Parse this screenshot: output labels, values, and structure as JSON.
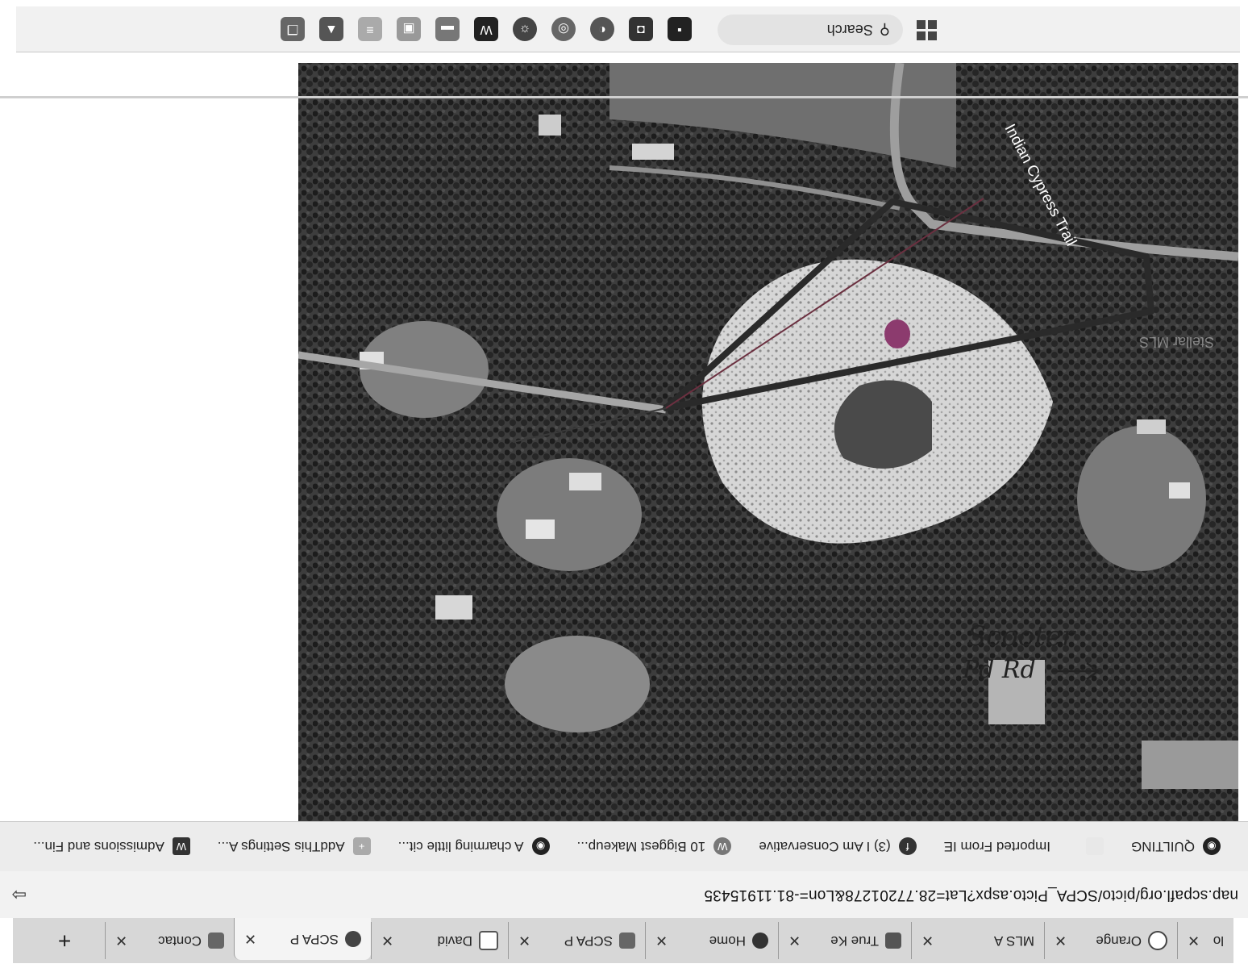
{
  "browser": {
    "tabs": [
      {
        "label": "lo",
        "active": false
      },
      {
        "label": "Orange",
        "active": false
      },
      {
        "label": "MLS A",
        "active": false
      },
      {
        "label": "True Ke",
        "active": false
      },
      {
        "label": "Home",
        "active": false
      },
      {
        "label": "SCPA P",
        "active": false
      },
      {
        "label": "David",
        "active": false
      },
      {
        "label": "SCPA P",
        "active": true
      },
      {
        "label": "Contac",
        "active": false
      }
    ],
    "new_tab_label": "+",
    "close_symbol": "✕",
    "url": "nap.scpafl.org/picto/SCPA_Picto.aspx?Lat=28.77201278&Lon=-81.11915435"
  },
  "favorites": [
    {
      "label": "QUILTING",
      "icon": "globe-icon"
    },
    {
      "label": "",
      "icon": "blank-icon"
    },
    {
      "label": "Imported From IE",
      "icon": "folder-icon"
    },
    {
      "label": "(3) I Am Conservative",
      "icon": "facebook-icon"
    },
    {
      "label": "10 Biggest Makeup...",
      "icon": "wish-icon"
    },
    {
      "label": "A charming little cit...",
      "icon": "globe-icon"
    },
    {
      "label": "AddThis Settings A...",
      "icon": "plus-icon"
    },
    {
      "label": "Admissions and Fin...",
      "icon": "w-icon"
    }
  ],
  "taskbar": {
    "search_label": "Search",
    "icons": [
      "start-icon",
      "search-icon",
      "task-view-icon",
      "chat-icon",
      "edge-icon",
      "chrome-icon",
      "settings-icon",
      "word-icon",
      "file-explorer-icon",
      "photos-icon",
      "notes-icon",
      "fire-icon",
      "copy-icon"
    ]
  },
  "map": {
    "road_label": "Indian Cypress Trail",
    "watermark": "Stellar MLS"
  },
  "annotation": {
    "line1": "Scooter",
    "line2": "Pd Rd"
  },
  "colors": {
    "tab_strip": "#d7d7d7",
    "active_tab": "#f4f4f4",
    "outline": "#2a2a2a",
    "pin": "#8c3b6e"
  }
}
